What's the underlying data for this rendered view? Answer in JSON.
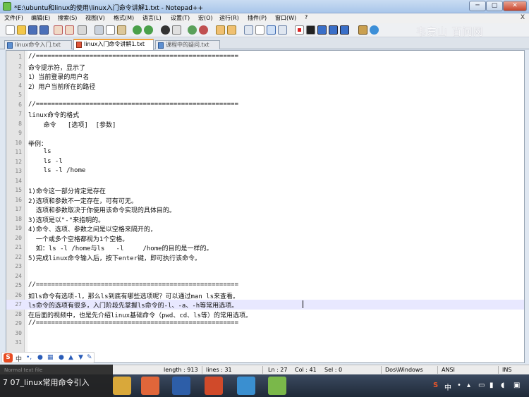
{
  "window": {
    "title": "*E:\\ubuntu和linux的使用\\linux入门命令讲解1.txt - Notepad++",
    "buttons": {
      "minimize": "─",
      "maximize": "▢",
      "close": "✕"
    }
  },
  "menu": {
    "items": [
      "文件(F)",
      "编辑(E)",
      "搜索(S)",
      "视图(V)",
      "格式(M)",
      "语言(L)",
      "设置(T)",
      "宏(O)",
      "运行(R)",
      "插件(P)",
      "窗口(W)",
      "?"
    ],
    "close_glyph": "X"
  },
  "toolbar": {
    "icons": [
      "new-file-icon",
      "open-file-icon",
      "save-icon",
      "save-all-icon",
      "close-icon",
      "close-all-icon",
      "print-icon",
      "cut-icon",
      "copy-icon",
      "paste-icon",
      "undo-icon",
      "redo-icon",
      "find-icon",
      "replace-icon",
      "zoom-in-icon",
      "zoom-out-icon",
      "sync-v-icon",
      "sync-h-icon",
      "wrap-icon",
      "all-chars-icon",
      "indent-guide-icon",
      "doc-map-icon",
      "record-macro-icon",
      "stop-macro-icon",
      "play-macro-icon",
      "run-macro-icon",
      "save-macro-icon",
      "tool-icon",
      "spell-icon"
    ]
  },
  "watermark": "韦东山 百问网",
  "tabs": [
    {
      "label": "linux命令入门.txt",
      "active": false
    },
    {
      "label": "linux入门命令讲解1.txt",
      "active": true
    },
    {
      "label": "课程中的疑问.txt",
      "active": false
    }
  ],
  "editor": {
    "current_line": 27,
    "lines": [
      "//=====================================================",
      "命令提示符，显示了",
      "1）当前登录的用户名",
      "2）用户当前所在的路径",
      "",
      "//=====================================================",
      "linux命令的格式",
      "    命令   [选项]  [参数]",
      "",
      "举例：",
      "    ls",
      "    ls -l",
      "    ls -l /home",
      "",
      "1)命令这一部分肯定是存在",
      "2)选项和参数不一定存在，可有可无。",
      "  选项和参数取决于你使用该命令实现的具体目的。",
      "3)选项是以\"-\"来指明的。",
      "4)命令、选项、参数之间是以空格来隔开的，",
      "  一个或多个空格都视为1个空格。",
      "  如：ls -l /home与ls   -l     /home的目的是一样的。",
      "5)完成linux命令输入后，按下enter键，即可执行该命令。",
      "",
      "",
      "//=====================================================",
      "如ls命令有选项-l，那么ls到底有哪些选项呢？可以通过man ls来查看。",
      "ls命令的选项有很多，入门阶段先掌握ls命令的-l、-a、-h等常用选项。",
      "在后面的视频中，也是先介绍linux基础命令（pwd、cd、ls等）的常用选项。",
      "//=====================================================",
      "",
      ""
    ]
  },
  "status": {
    "type": "Normal text file",
    "length": "length : 913",
    "lines": "lines : 31",
    "ln": "Ln : 27",
    "col": "Col : 41",
    "sel": "Sel : 0",
    "eol": "Dos\\Windows",
    "encoding": "ANSI",
    "mode": "INS"
  },
  "ime": {
    "logo": "S",
    "mode": "中"
  },
  "video_caption": "7 07_linux常用命令引入",
  "taskbar": {
    "apps": [
      "folder-icon",
      "pdf-icon",
      "word-icon",
      "powerpoint-icon",
      "yinxiang-icon",
      "notepadpp-icon"
    ]
  }
}
